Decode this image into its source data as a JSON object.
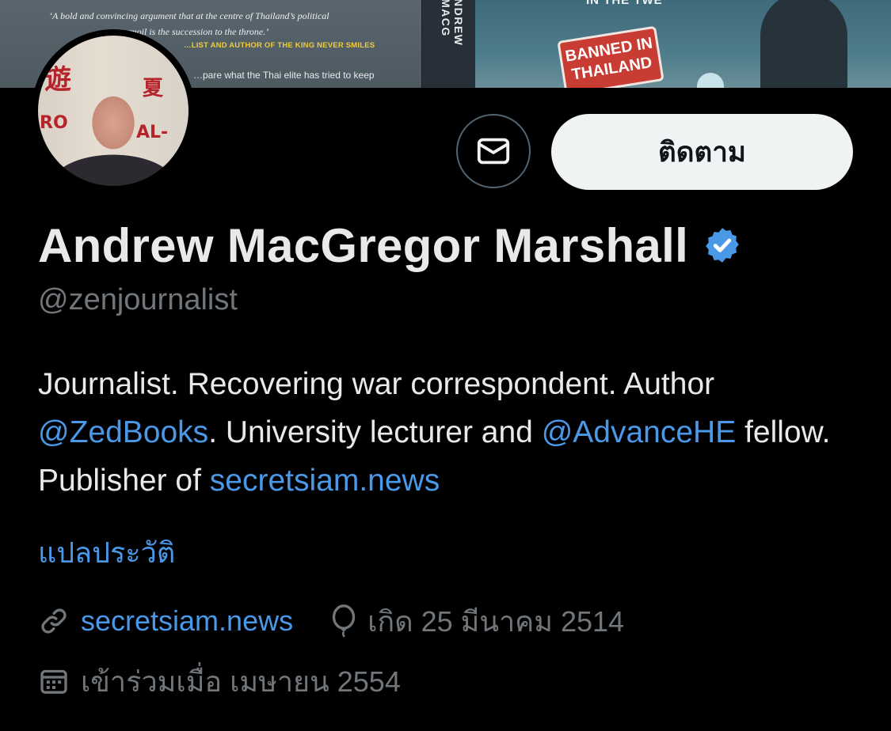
{
  "banner": {
    "quote_line1": "‘A bold and convincing argument that at the centre of Thailand’s political",
    "quote_line2": "turmoil is the succession to the throne.’",
    "quote_author": "…LIST AND AUTHOR OF THE KING NEVER SMILES",
    "quote_body": "…pare what the Thai elite has tried to keep",
    "spine_text": "NDREW MACG",
    "front_top": "IN THE TWE",
    "banned_label": "BANNED IN THAILAND"
  },
  "profile": {
    "display_name": "Andrew MacGregor Marshall",
    "handle": "@zenjournalist",
    "verified": true,
    "message_icon": "envelope-icon",
    "follow_label": "ติดตาม"
  },
  "bio": {
    "part1": "Journalist. Recovering war correspondent. Author ",
    "mention1": "@ZedBooks",
    "part2": ". University lecturer and ",
    "mention2": "@AdvanceHE",
    "part3": " fellow. Publisher of ",
    "link": "secretsiam.news",
    "translate_label": "แปลประวัติ"
  },
  "meta": {
    "website": "secretsiam.news",
    "birth": "เกิด 25 มีนาคม 2514",
    "joined": "เข้าร่วมเมื่อ เมษายน 2554"
  },
  "colors": {
    "background": "#000000",
    "text": "#e7e9ea",
    "secondary": "#71767b",
    "link": "#4a99e9",
    "follow_button": "#eff3f4",
    "verified": "#4a99e9"
  }
}
